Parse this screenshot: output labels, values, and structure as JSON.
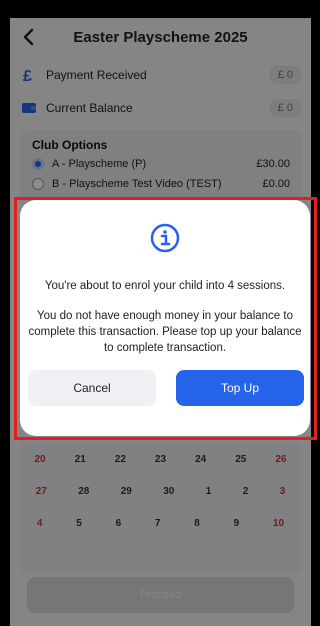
{
  "header": {
    "title": "Easter Playscheme 2025"
  },
  "summary": {
    "payment_received": {
      "label": "Payment Received",
      "value": "£ 0"
    },
    "current_balance": {
      "label": "Current Balance",
      "value": "£ 0"
    }
  },
  "club_options": {
    "heading": "Club Options",
    "items": [
      {
        "label": "A - Playscheme (P)",
        "price": "£30.00",
        "selected": true
      },
      {
        "label": "B - Playscheme Test Video (TEST)",
        "price": "£0.00",
        "selected": false
      }
    ]
  },
  "calendar": {
    "rows": [
      [
        "20",
        "21",
        "22",
        "23",
        "24",
        "25",
        "26"
      ],
      [
        "27",
        "28",
        "29",
        "30",
        "1",
        "2",
        "3"
      ],
      [
        "4",
        "5",
        "6",
        "7",
        "8",
        "9",
        "10"
      ]
    ]
  },
  "proceed_label": "Proceed",
  "modal": {
    "message_sessions": "You're about to enrol your child into 4 sessions.",
    "message_balance": "You do not have enough money in your balance to complete this transaction. Please top up your balance to complete transaction.",
    "cancel_label": "Cancel",
    "topup_label": "Top Up"
  },
  "colors": {
    "accent": "#2563eb",
    "weekend": "#c0392b",
    "highlight": "#e02020"
  }
}
